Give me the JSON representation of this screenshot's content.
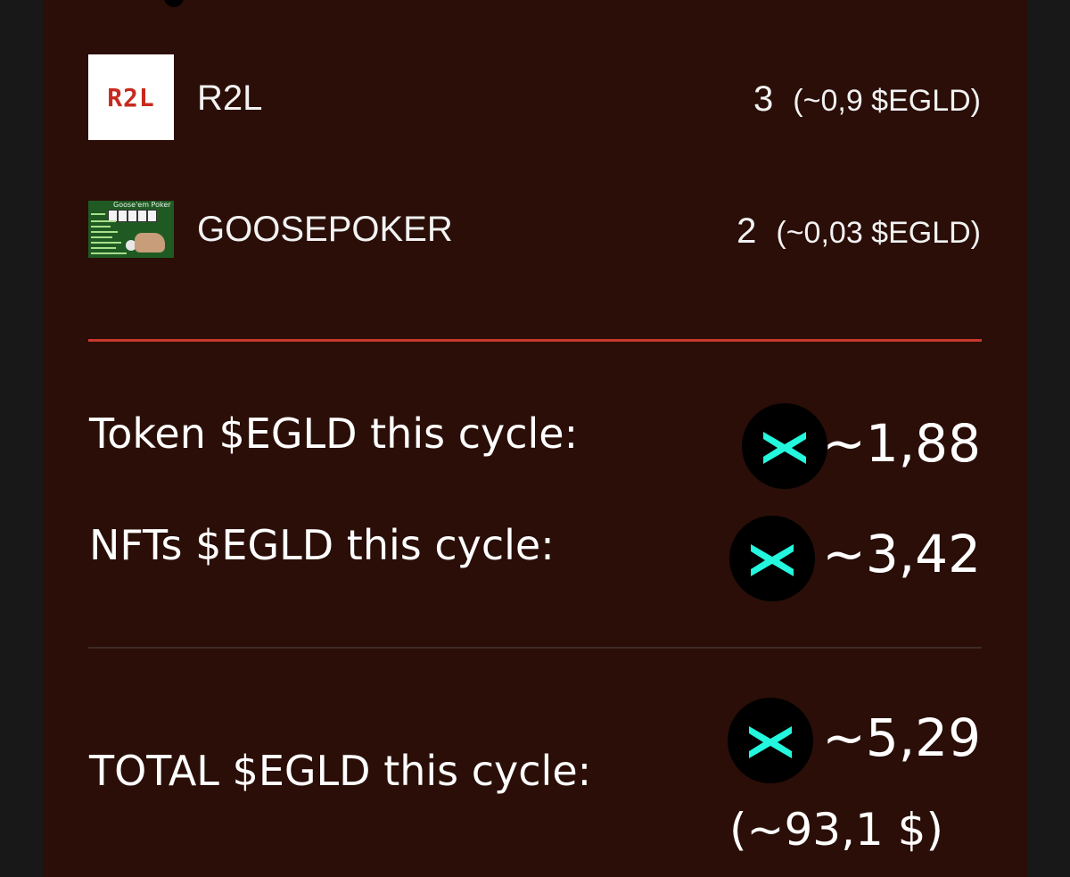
{
  "assets": [
    {
      "name": "R2L",
      "logo_text": "R2L",
      "count": "3",
      "egld_value": "(~0,9 $EGLD)"
    },
    {
      "name": "GOOSEPOKER",
      "logo_text": "Goose'em Poker",
      "count": "2",
      "egld_value": "(~0,03 $EGLD)"
    }
  ],
  "summary": {
    "token": {
      "label": "Token $EGLD this cycle:",
      "value": "~1,88"
    },
    "nfts": {
      "label": "NFTs $EGLD this cycle:",
      "value": "~3,42"
    },
    "total": {
      "label": "TOTAL $EGLD this cycle:",
      "value": "~5,29",
      "usd": "(~93,1 $)"
    }
  },
  "icons": {
    "egld": "multiversx-egld-icon"
  },
  "colors": {
    "background": "#2a0e07",
    "divider_accent": "#c8382c",
    "egld_teal": "#23f7dd",
    "r2l_red": "#c62a1e"
  }
}
